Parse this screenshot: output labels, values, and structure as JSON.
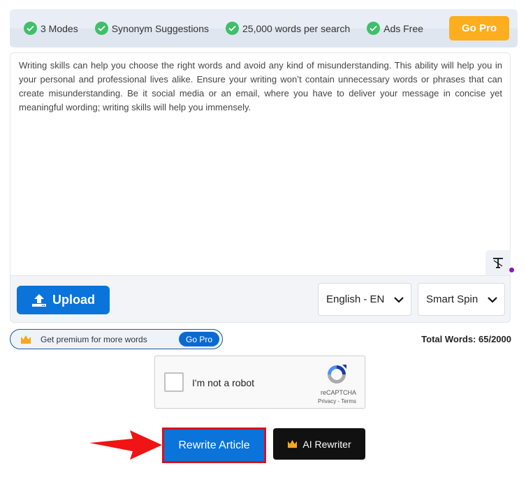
{
  "features": [
    {
      "icon": "check-circle-icon",
      "label": "3 Modes"
    },
    {
      "icon": "check-circle-icon",
      "label": "Synonym Suggestions"
    },
    {
      "icon": "check-circle-icon",
      "label": "25,000 words per search"
    },
    {
      "icon": "check-circle-icon",
      "label": "Ads Free"
    }
  ],
  "header": {
    "go_pro_label": "Go Pro"
  },
  "editor": {
    "text": "Writing skills can help you choose the right words and avoid any kind of misunderstanding. This ability will help you in your personal and professional lives alike. Ensure your writing won’t contain unnecessary words or phrases that can create misunderstanding. Be it social media or an email, where you have to deliver your message in concise yet meaningful wording; writing skills will help you immensely.",
    "font_icon": "text-format-icon"
  },
  "toolbar": {
    "upload_label": "Upload",
    "language_select": {
      "value": "English - EN"
    },
    "mode_select": {
      "value": "Smart Spin"
    }
  },
  "premium": {
    "message": "Get premium for more words",
    "go_pro_label": "Go Pro"
  },
  "word_count": {
    "label": "Total Words: 65/2000",
    "current": 65,
    "max": 2000
  },
  "recaptcha": {
    "label": "I'm not a robot",
    "brand": "reCAPTCHA",
    "links": "Privacy - Terms"
  },
  "actions": {
    "rewrite_label": "Rewrite Article",
    "ai_rewriter_label": "AI Rewriter"
  },
  "colors": {
    "accent_blue": "#0a74da",
    "go_pro_orange": "#fcae1f",
    "check_green": "#3fbf6a",
    "highlight_red": "#d8111e"
  }
}
